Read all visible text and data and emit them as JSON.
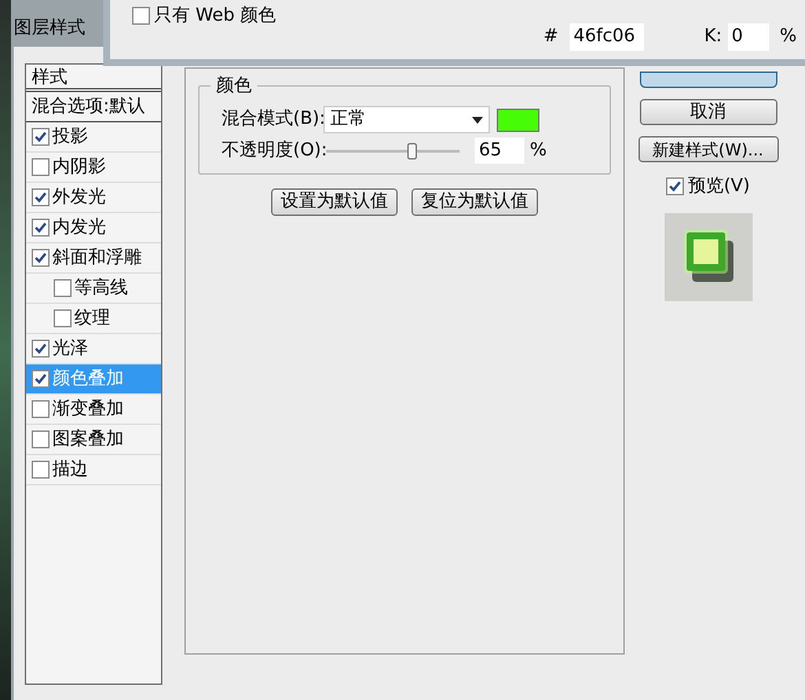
{
  "color_picker": {
    "web_only": {
      "label": "只有 Web 颜色",
      "checked": false
    },
    "hex": {
      "label": "#",
      "value": "46fc06"
    },
    "k": {
      "label": "K:",
      "value": "0",
      "unit": "%"
    }
  },
  "window": {
    "title": "图层样式"
  },
  "styles": {
    "header": "样式",
    "blend_options": "混合选项:默认",
    "items": [
      {
        "label": "投影",
        "checked": true,
        "selected": false
      },
      {
        "label": "内阴影",
        "checked": false,
        "selected": false
      },
      {
        "label": "外发光",
        "checked": true,
        "selected": false
      },
      {
        "label": "内发光",
        "checked": true,
        "selected": false
      },
      {
        "label": "斜面和浮雕",
        "checked": true,
        "selected": false,
        "children": [
          {
            "label": "等高线",
            "checked": false,
            "selected": false
          },
          {
            "label": "纹理",
            "checked": false,
            "selected": false
          }
        ]
      },
      {
        "label": "光泽",
        "checked": true,
        "selected": false
      },
      {
        "label": "颜色叠加",
        "checked": true,
        "selected": true
      },
      {
        "label": "渐变叠加",
        "checked": false,
        "selected": false
      },
      {
        "label": "图案叠加",
        "checked": false,
        "selected": false
      },
      {
        "label": "描边",
        "checked": false,
        "selected": false
      }
    ]
  },
  "color_group": {
    "title": "颜色",
    "blend_mode": {
      "label": "混合模式(B):",
      "value": "正常",
      "color": "#46fc06"
    },
    "opacity": {
      "label": "不透明度(O):",
      "level": 0.65,
      "value": "65",
      "unit": "%"
    },
    "buttons": [
      "设置为默认值",
      "复位为默认值"
    ]
  },
  "actions": {
    "cancel": "取消",
    "new_style": "新建样式(W)...",
    "preview": {
      "label": "预览(V)",
      "checked": true
    }
  }
}
